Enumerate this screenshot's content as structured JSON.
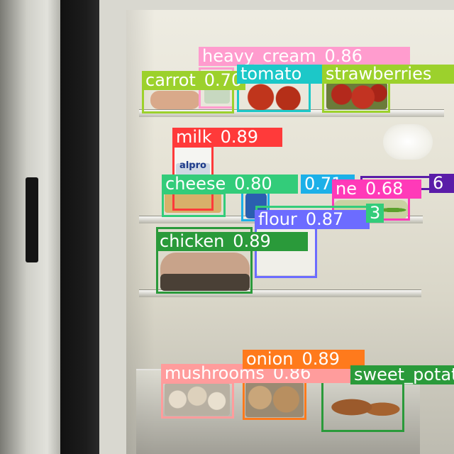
{
  "image": {
    "package_brand_text": "alpro"
  },
  "detections": [
    {
      "label": "heavy_cream",
      "score": "0.86",
      "color": "#ff9cce"
    },
    {
      "label": "carrot",
      "score": "0.70",
      "color": "#9cd12c"
    },
    {
      "label": "tomato",
      "score": "",
      "color": "#1cc8c8"
    },
    {
      "label": "strawberries",
      "score": "",
      "color": "#9cd12c"
    },
    {
      "label": "milk",
      "score": "0.89",
      "color": "#ff3a3a"
    },
    {
      "label": "cheese",
      "score": "0.80",
      "color": "#33cc7a"
    },
    {
      "label": "",
      "score": "0.71",
      "color": "#1cb0e8"
    },
    {
      "label": "ne",
      "score": "0.68",
      "color": "#ff3ab8"
    },
    {
      "label": "",
      "score": "6",
      "color": "#5a1ca8"
    },
    {
      "label": "flour",
      "score": "0.87",
      "color": "#6c6cff"
    },
    {
      "label": "",
      "score": "3",
      "color": "#33cc7a"
    },
    {
      "label": "chicken",
      "score": "0.89",
      "color": "#2a9a3a"
    },
    {
      "label": "mushrooms",
      "score": "0.86",
      "color": "#ff9c9c"
    },
    {
      "label": "onion",
      "score": "0.89",
      "color": "#ff7a1c"
    },
    {
      "label": "sweet_potato",
      "score": "",
      "color": "#2a9a3a"
    }
  ]
}
